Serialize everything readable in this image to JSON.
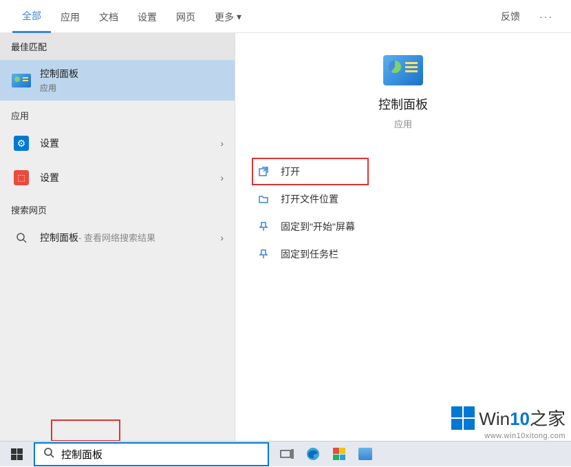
{
  "tabs": {
    "items": [
      "全部",
      "应用",
      "文档",
      "设置",
      "网页",
      "更多"
    ],
    "feedback": "反馈"
  },
  "sections": {
    "best_match": "最佳匹配",
    "apps": "应用",
    "web": "搜索网页"
  },
  "best_match_item": {
    "title": "控制面板",
    "sub": "应用"
  },
  "app_items": [
    {
      "title": "设置"
    },
    {
      "title": "设置"
    }
  ],
  "web_item": {
    "title": "控制面板",
    "sub": " - 查看网络搜索结果"
  },
  "preview": {
    "title": "控制面板",
    "sub": "应用"
  },
  "actions": [
    {
      "icon": "open",
      "label": "打开"
    },
    {
      "icon": "folder",
      "label": "打开文件位置"
    },
    {
      "icon": "pin-start",
      "label": "固定到\"开始\"屏幕"
    },
    {
      "icon": "pin-taskbar",
      "label": "固定到任务栏"
    }
  ],
  "search": {
    "value": "控制面板"
  },
  "watermark": {
    "brand_pre": "Win",
    "brand_num": "10",
    "brand_post": "之家",
    "url": "www.win10xitong.com"
  }
}
